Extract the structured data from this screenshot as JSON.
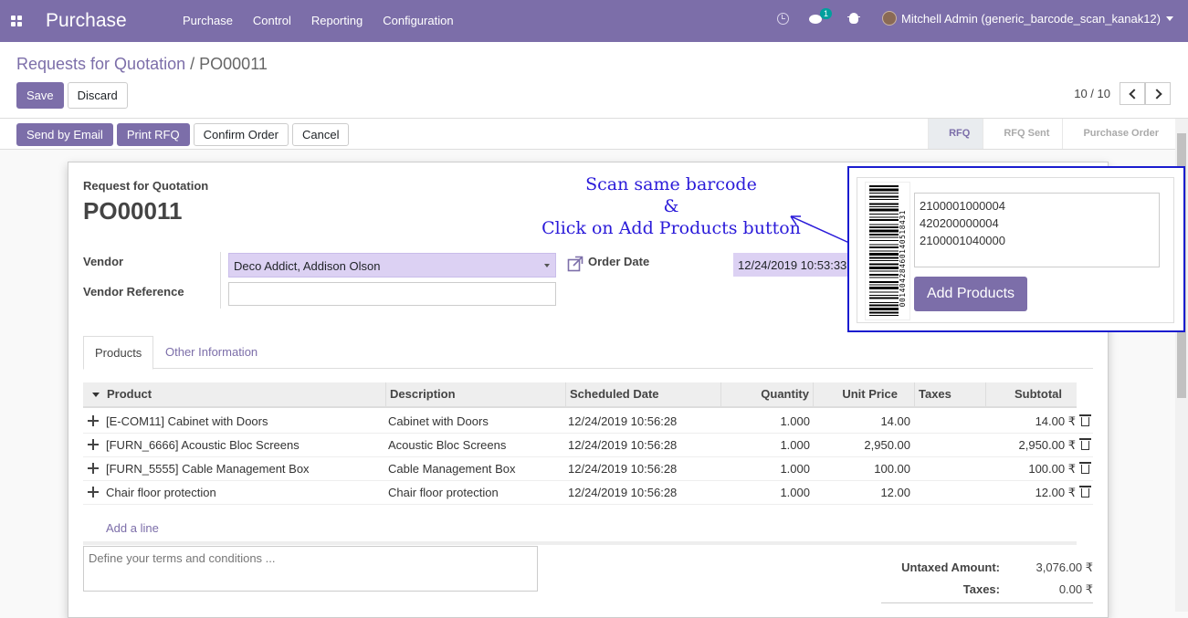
{
  "navbar": {
    "brand": "Purchase",
    "menu": [
      "Purchase",
      "Control",
      "Reporting",
      "Configuration"
    ],
    "chat_badge": "1",
    "user": "Mitchell Admin (generic_barcode_scan_kanak12)"
  },
  "breadcrumb": {
    "parent": "Requests for Quotation",
    "separator": "/",
    "current": "PO00011"
  },
  "control": {
    "save": "Save",
    "discard": "Discard",
    "pager": "10 / 10"
  },
  "statusbar": {
    "buttons": [
      "Send by Email",
      "Print RFQ",
      "Confirm Order",
      "Cancel"
    ],
    "stages": [
      "RFQ",
      "RFQ Sent",
      "Purchase Order"
    ],
    "active_stage": "RFQ"
  },
  "sheet": {
    "subtitle": "Request for Quotation",
    "title": "PO00011",
    "vendor_label": "Vendor",
    "vendor_value": "Deco Addict, Addison Olson",
    "vendor_ref_label": "Vendor Reference",
    "vendor_ref_value": "",
    "order_date_label": "Order Date",
    "order_date_value": "12/24/2019 10:53:33"
  },
  "tabs": [
    "Products",
    "Other Information"
  ],
  "table": {
    "headers": [
      "Product",
      "Description",
      "Scheduled Date",
      "Quantity",
      "Unit Price",
      "Taxes",
      "Subtotal"
    ],
    "rows": [
      {
        "product": "[E-COM11] Cabinet with Doors",
        "description": "Cabinet with Doors",
        "date": "12/24/2019 10:56:28",
        "qty": "1.000",
        "price": "14.00",
        "taxes": "",
        "subtotal": "14.00 ₹"
      },
      {
        "product": "[FURN_6666] Acoustic Bloc Screens",
        "description": "Acoustic Bloc Screens",
        "date": "12/24/2019 10:56:28",
        "qty": "1.000",
        "price": "2,950.00",
        "taxes": "",
        "subtotal": "2,950.00 ₹"
      },
      {
        "product": "[FURN_5555] Cable Management Box",
        "description": "Cable Management Box",
        "date": "12/24/2019 10:56:28",
        "qty": "1.000",
        "price": "100.00",
        "taxes": "",
        "subtotal": "100.00 ₹"
      },
      {
        "product": "Chair floor protection",
        "description": "Chair floor protection",
        "date": "12/24/2019 10:56:28",
        "qty": "1.000",
        "price": "12.00",
        "taxes": "",
        "subtotal": "12.00 ₹"
      }
    ],
    "add_line": "Add a line"
  },
  "terms_placeholder": "Define your terms and conditions ...",
  "totals": {
    "untaxed_label": "Untaxed Amount:",
    "untaxed_value": "3,076.00 ₹",
    "taxes_label": "Taxes:",
    "taxes_value": "0.00 ₹"
  },
  "annotation": {
    "line1": "Scan same barcode",
    "line2": "&",
    "line3": "Click on Add Products button"
  },
  "barcode_popup": {
    "barcode_number": "00140428460140518431",
    "scanned": [
      "2100001000004",
      "420200000004",
      "2100001040000"
    ],
    "button": "Add Products"
  },
  "colors": {
    "brand": "#7c6ea9",
    "annotation": "#2a1ad9",
    "highlight_border": "#1a1ccf"
  }
}
